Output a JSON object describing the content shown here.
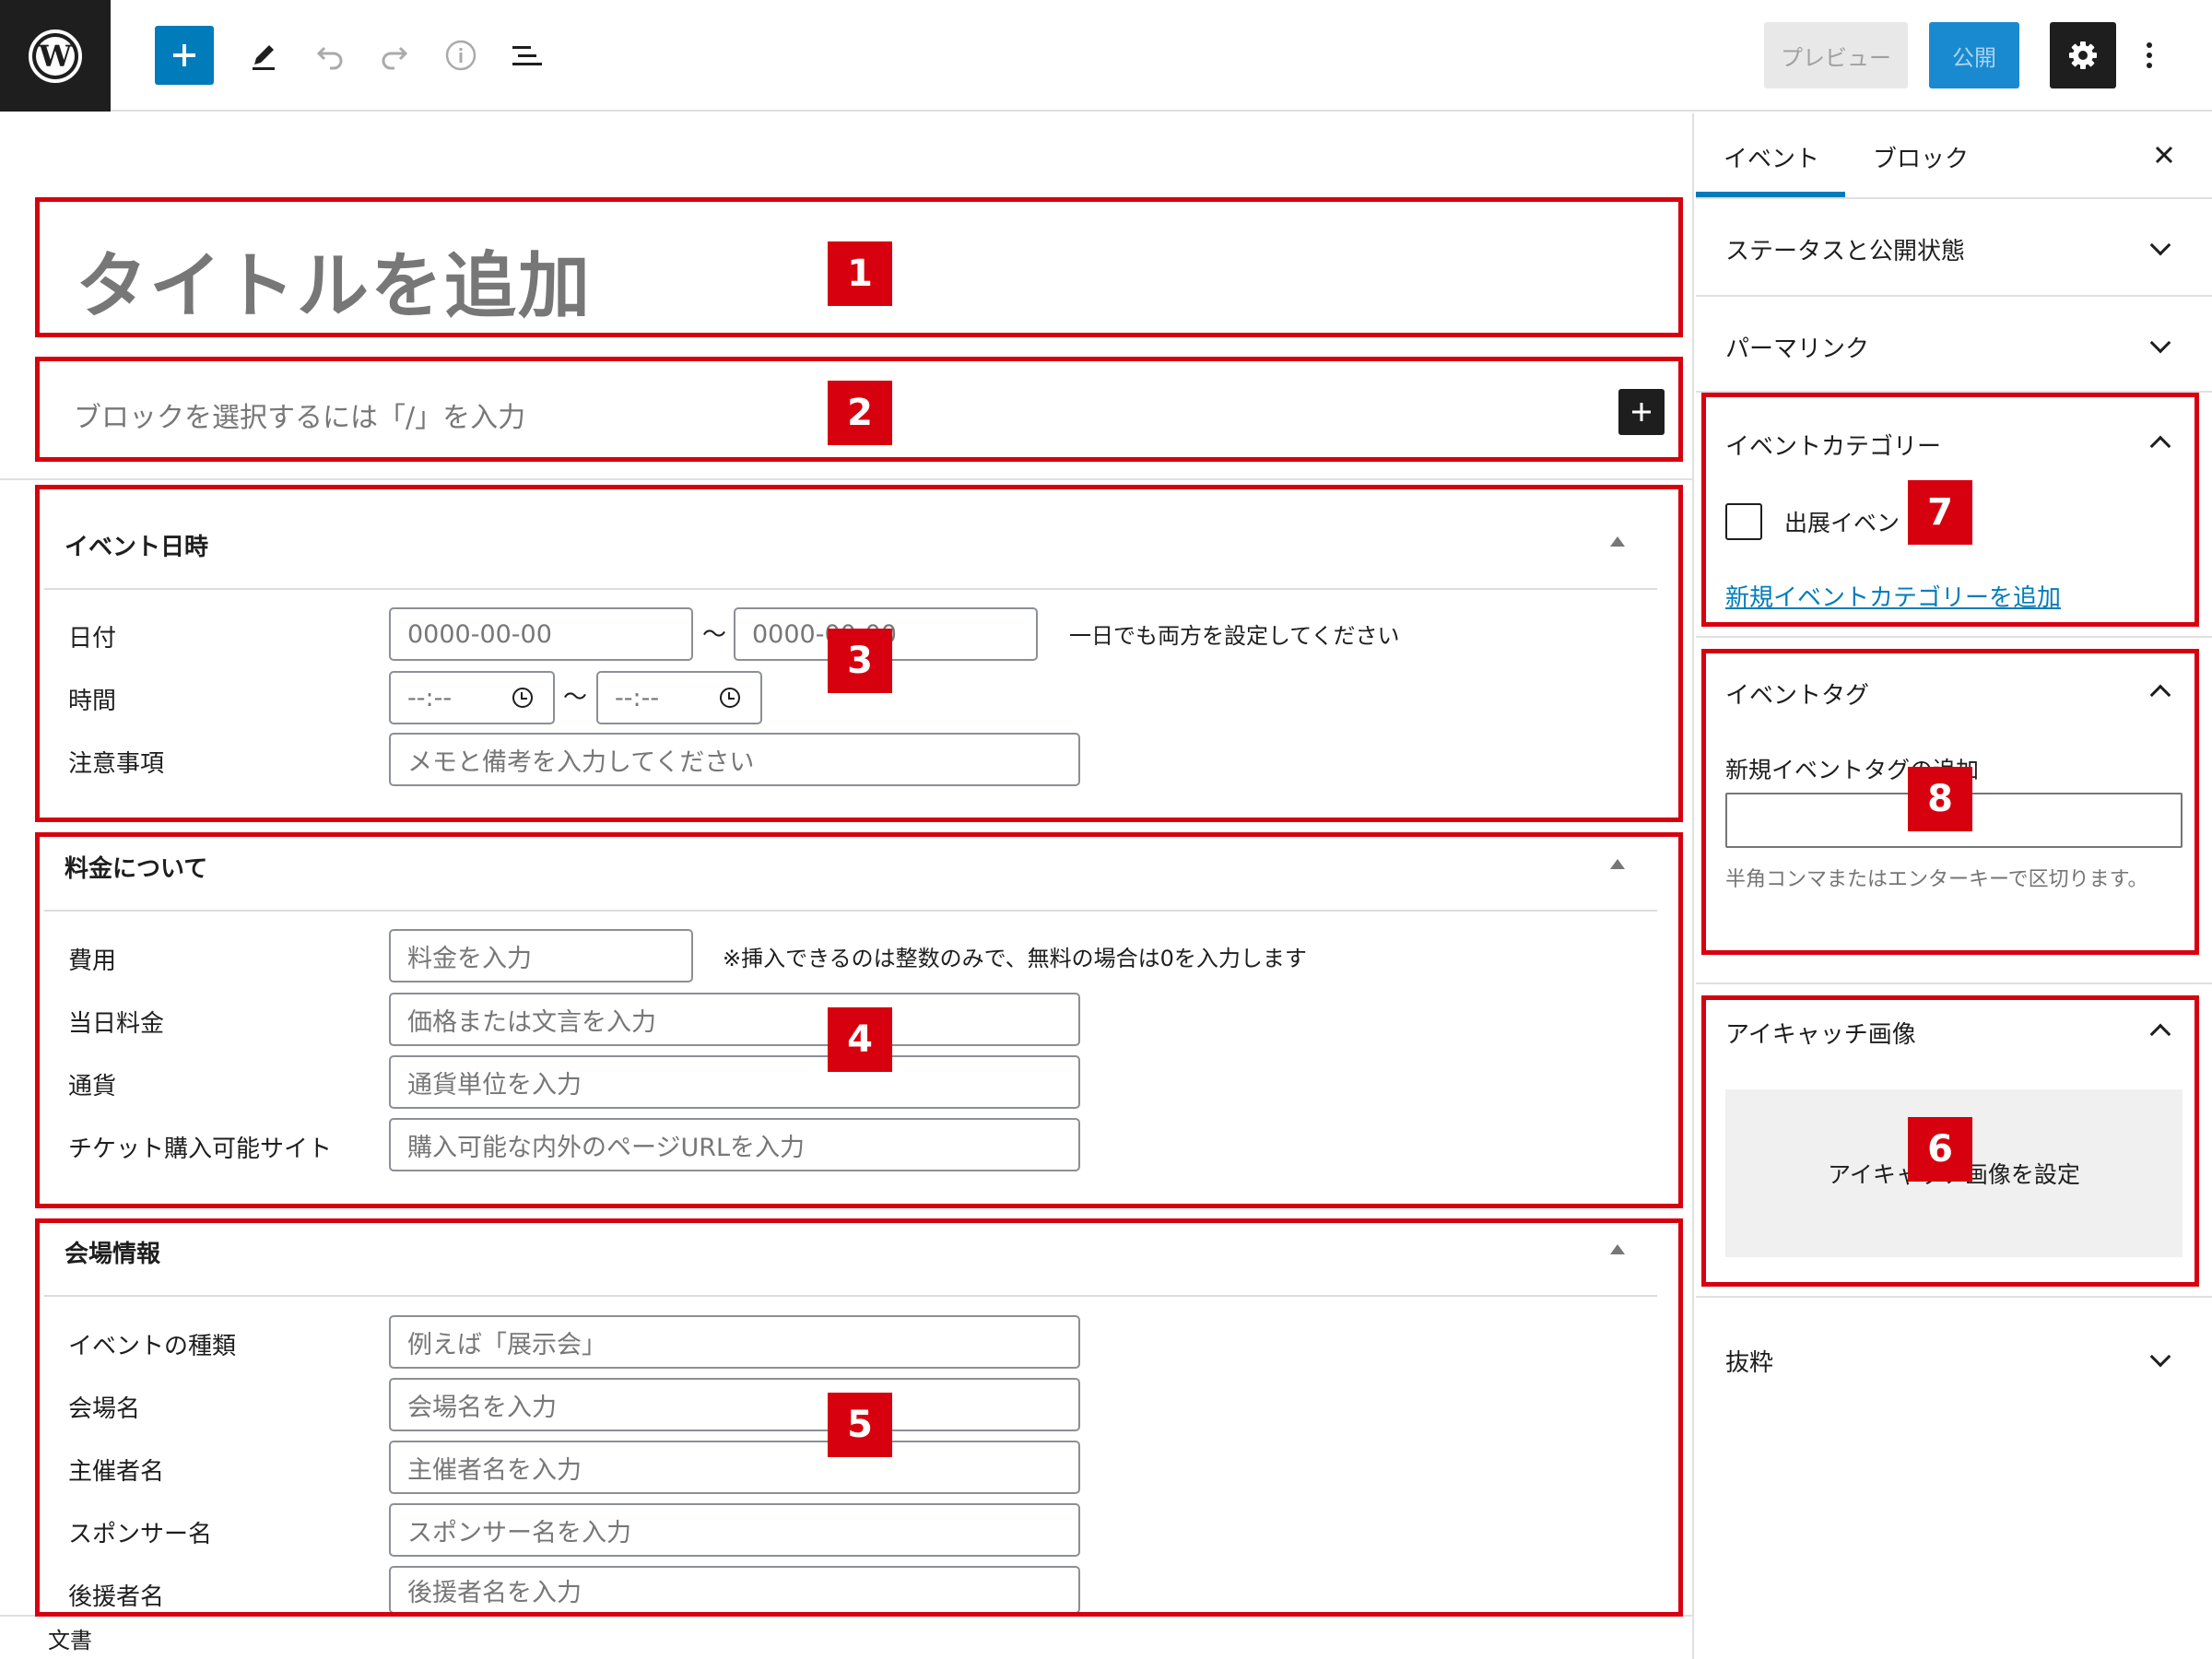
{
  "toolbar": {
    "preview_label": "プレビュー",
    "publish_label": "公開",
    "icons": [
      "wordpress-logo",
      "plus",
      "pencil",
      "undo",
      "redo",
      "info",
      "list-view",
      "gear",
      "more-vertical"
    ]
  },
  "editor": {
    "title_placeholder": "タイトルを追加",
    "block_placeholder": "ブロックを選択するには「/」を入力",
    "footer_breadcrumb": "文書"
  },
  "event_datetime": {
    "heading": "イベント日時",
    "date_label": "日付",
    "date_start": "0000-00-00",
    "date_end": "0000-00-00",
    "tilde": "〜",
    "date_note": "一日でも両方を設定してください",
    "time_label": "時間",
    "time_start": "--:--",
    "time_end": "--:--",
    "notes_label": "注意事項",
    "notes_placeholder": "メモと備考を入力してください"
  },
  "pricing": {
    "heading": "料金について",
    "fee_label": "費用",
    "fee_placeholder": "料金を入力",
    "fee_note": "※挿入できるのは整数のみで、無料の場合は0を入力します",
    "door_label": "当日料金",
    "door_placeholder": "価格または文言を入力",
    "currency_label": "通貨",
    "currency_placeholder": "通貨単位を入力",
    "ticket_label": "チケット購入可能サイト",
    "ticket_placeholder": "購入可能な内外のページURLを入力"
  },
  "venue": {
    "heading": "会場情報",
    "type_label": "イベントの種類",
    "type_placeholder": "例えば「展示会」",
    "venue_label": "会場名",
    "venue_placeholder": "会場名を入力",
    "organizer_label": "主催者名",
    "organizer_placeholder": "主催者名を入力",
    "sponsor_label": "スポンサー名",
    "sponsor_placeholder": "スポンサー名を入力",
    "supporter_label": "後援者名",
    "supporter_placeholder": "後援者名を入力"
  },
  "sidebar": {
    "tabs": [
      "イベント",
      "ブロック"
    ],
    "active_tab": "イベント",
    "status_heading": "ステータスと公開状態",
    "permalink_heading": "パーマリンク",
    "category_heading": "イベントカテゴリー",
    "category_item": "出展イベン",
    "category_checked": false,
    "add_category_link": "新規イベントカテゴリーを追加",
    "tag_heading": "イベントタグ",
    "tag_label": "新規イベントタグの追加",
    "tag_help": "半角コンマまたはエンターキーで区切ります。",
    "featured_heading": "アイキャッチ画像",
    "featured_button": "アイキャッチ画像を設定",
    "excerpt_heading": "抜粋"
  },
  "annotations": [
    "1",
    "2",
    "3",
    "4",
    "5",
    "6",
    "7",
    "8"
  ],
  "colors": {
    "accent": "#007cba",
    "annotation_red": "#d7000f",
    "dark": "#1e1e1e"
  }
}
